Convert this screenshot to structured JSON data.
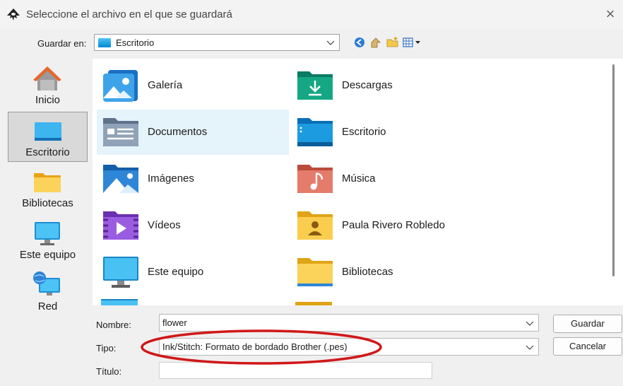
{
  "window": {
    "title": "Seleccione el archivo en el que se guardará"
  },
  "save_in": {
    "label": "Guardar en:",
    "value": "Escritorio"
  },
  "places": [
    {
      "label": "Inicio"
    },
    {
      "label": "Escritorio"
    },
    {
      "label": "Bibliotecas"
    },
    {
      "label": "Este equipo"
    },
    {
      "label": "Red"
    }
  ],
  "files": [
    {
      "name": "Galería",
      "icon": "gallery-icon"
    },
    {
      "name": "Descargas",
      "icon": "downloads-folder-icon"
    },
    {
      "name": "Documentos",
      "icon": "documents-folder-icon"
    },
    {
      "name": "Escritorio",
      "icon": "desktop-folder-icon"
    },
    {
      "name": "Imágenes",
      "icon": "pictures-folder-icon"
    },
    {
      "name": "Música",
      "icon": "music-folder-icon"
    },
    {
      "name": "Vídeos",
      "icon": "videos-folder-icon"
    },
    {
      "name": "Paula Rivero Robledo",
      "icon": "user-folder-icon"
    },
    {
      "name": "Este equipo",
      "icon": "computer-icon"
    },
    {
      "name": "Bibliotecas",
      "icon": "libraries-folder-icon"
    }
  ],
  "form": {
    "name_label": "Nombre:",
    "name_value": "flower",
    "type_label": "Tipo:",
    "type_value": "Ink/Stitch: Formato de bordado Brother (.pes)",
    "title_label": "Título:",
    "title_value": ""
  },
  "buttons": {
    "save": "Guardar",
    "cancel": "Cancelar"
  },
  "colors": {
    "selection": "#e5f3fb",
    "annotation": "#d01818",
    "accent": "#0078d4"
  }
}
